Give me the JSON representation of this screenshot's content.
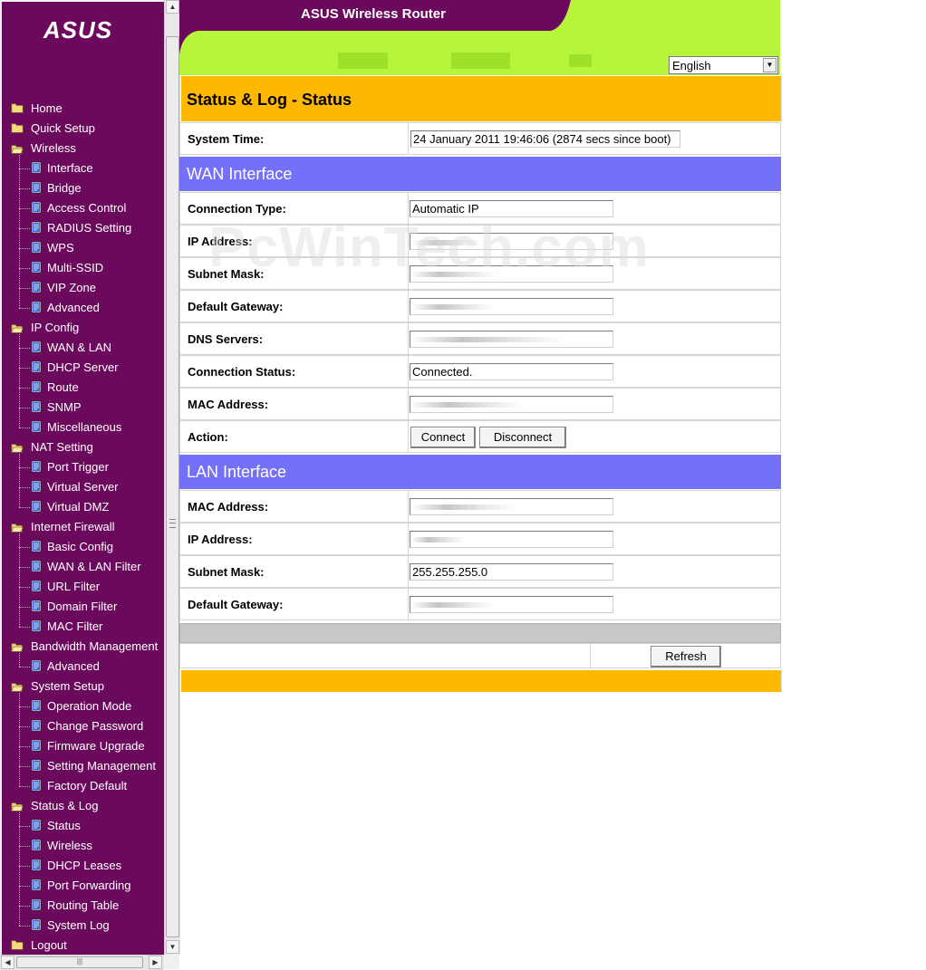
{
  "brand": {
    "logo_text": "ASUS"
  },
  "banner": {
    "title": "ASUS Wireless Router"
  },
  "language_select": {
    "selected": "English"
  },
  "sidebar": {
    "home": "Home",
    "quick_setup": "Quick Setup",
    "wireless": {
      "label": "Wireless",
      "items": [
        "Interface",
        "Bridge",
        "Access Control",
        "RADIUS Setting",
        "WPS",
        "Multi-SSID",
        "VIP Zone",
        "Advanced"
      ]
    },
    "ip_config": {
      "label": "IP Config",
      "items": [
        "WAN & LAN",
        "DHCP Server",
        "Route",
        "SNMP",
        "Miscellaneous"
      ]
    },
    "nat_setting": {
      "label": "NAT Setting",
      "items": [
        "Port Trigger",
        "Virtual Server",
        "Virtual DMZ"
      ]
    },
    "internet_firewall": {
      "label": "Internet Firewall",
      "items": [
        "Basic Config",
        "WAN & LAN Filter",
        "URL Filter",
        "Domain Filter",
        "MAC Filter"
      ]
    },
    "bandwidth_management": {
      "label": "Bandwidth Management",
      "items": [
        "Advanced"
      ]
    },
    "system_setup": {
      "label": "System Setup",
      "items": [
        "Operation Mode",
        "Change Password",
        "Firmware Upgrade",
        "Setting Management",
        "Factory Default"
      ]
    },
    "status_log": {
      "label": "Status & Log",
      "items": [
        "Status",
        "Wireless",
        "DHCP Leases",
        "Port Forwarding",
        "Routing Table",
        "System Log"
      ]
    },
    "logout": "Logout"
  },
  "page": {
    "title": "Status & Log - Status",
    "system_time_label": "System Time:",
    "system_time_value": "24 January 2011 19:46:06 (2874 secs since boot)"
  },
  "wan": {
    "header": "WAN Interface",
    "connection_type_label": "Connection Type:",
    "connection_type_value": "Automatic IP",
    "ip_address_label": "IP Address:",
    "subnet_mask_label": "Subnet Mask:",
    "default_gateway_label": "Default Gateway:",
    "dns_servers_label": "DNS Servers:",
    "connection_status_label": "Connection Status:",
    "connection_status_value": "Connected.",
    "mac_address_label": "MAC Address:",
    "action_label": "Action:",
    "connect_button": "Connect",
    "disconnect_button": "Disconnect"
  },
  "lan": {
    "header": "LAN Interface",
    "mac_address_label": "MAC Address:",
    "ip_address_label": "IP Address:",
    "subnet_mask_label": "Subnet Mask:",
    "subnet_mask_value": "255.255.255.0",
    "default_gateway_label": "Default Gateway:"
  },
  "footer": {
    "refresh_button": "Refresh"
  },
  "watermark": "PcWinTech.com",
  "colors": {
    "sidebar": "#6b0a5c",
    "banner": "#b7f53a",
    "title_bar": "#ffb800",
    "section_header": "#7470f7"
  }
}
